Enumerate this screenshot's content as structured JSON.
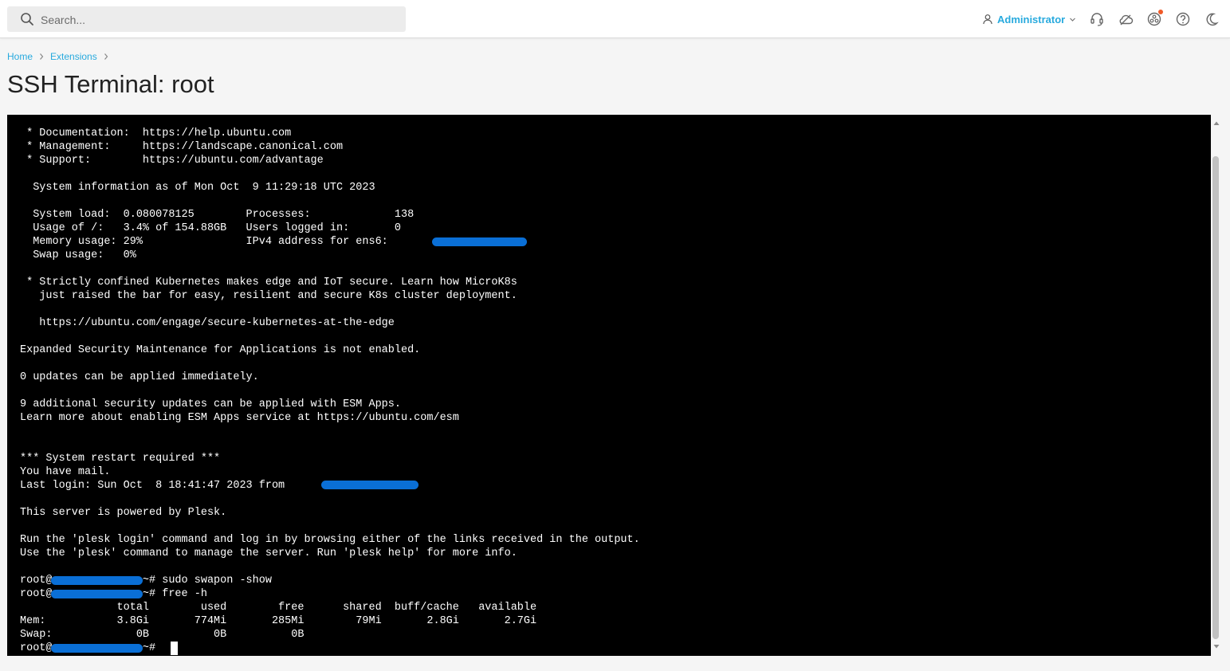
{
  "header": {
    "search_placeholder": "Search...",
    "user_label": "Administrator",
    "icons": [
      "search-icon",
      "user-icon",
      "chevron-down-icon",
      "headset-icon",
      "cloud-icon",
      "community-icon",
      "help-icon",
      "moon-icon"
    ],
    "accent_color": "#28aade",
    "notification_color": "#f05a28"
  },
  "breadcrumb": {
    "items": [
      "Home",
      "Extensions"
    ]
  },
  "page": {
    "title": "SSH Terminal: root"
  },
  "terminal": {
    "background": "#000000",
    "foreground": "#ffffff",
    "redaction_color": "#0a6fd6",
    "lines": [
      " * Documentation:  https://help.ubuntu.com",
      " * Management:     https://landscape.canonical.com",
      " * Support:        https://ubuntu.com/advantage",
      "",
      "  System information as of Mon Oct  9 11:29:18 UTC 2023",
      "",
      "  System load:  0.080078125        Processes:             138",
      "  Usage of /:   3.4% of 154.88GB   Users logged in:       0",
      "  Memory usage: 29%                IPv4 address for ens6:",
      "  Swap usage:   0%",
      "",
      " * Strictly confined Kubernetes makes edge and IoT secure. Learn how MicroK8s",
      "   just raised the bar for easy, resilient and secure K8s cluster deployment.",
      "",
      "   https://ubuntu.com/engage/secure-kubernetes-at-the-edge",
      "",
      "Expanded Security Maintenance for Applications is not enabled.",
      "",
      "0 updates can be applied immediately.",
      "",
      "9 additional security updates can be applied with ESM Apps.",
      "Learn more about enabling ESM Apps service at https://ubuntu.com/esm",
      "",
      "",
      "*** System restart required ***",
      "You have mail.",
      "Last login: Sun Oct  8 18:41:47 2023 from",
      "",
      "This server is powered by Plesk.",
      "",
      "Run the 'plesk login' command and log in by browsing either of the links received in the output.",
      "Use the 'plesk' command to manage the server. Run 'plesk help' for more info.",
      "",
      "root@             :~# sudo swapon -show",
      "root@             :~# free -h",
      "               total        used        free      shared  buff/cache   available",
      "Mem:           3.8Gi       774Mi       285Mi        79Mi       2.8Gi       2.7Gi",
      "Swap:             0B          0B          0B",
      "root@             :~#"
    ]
  }
}
